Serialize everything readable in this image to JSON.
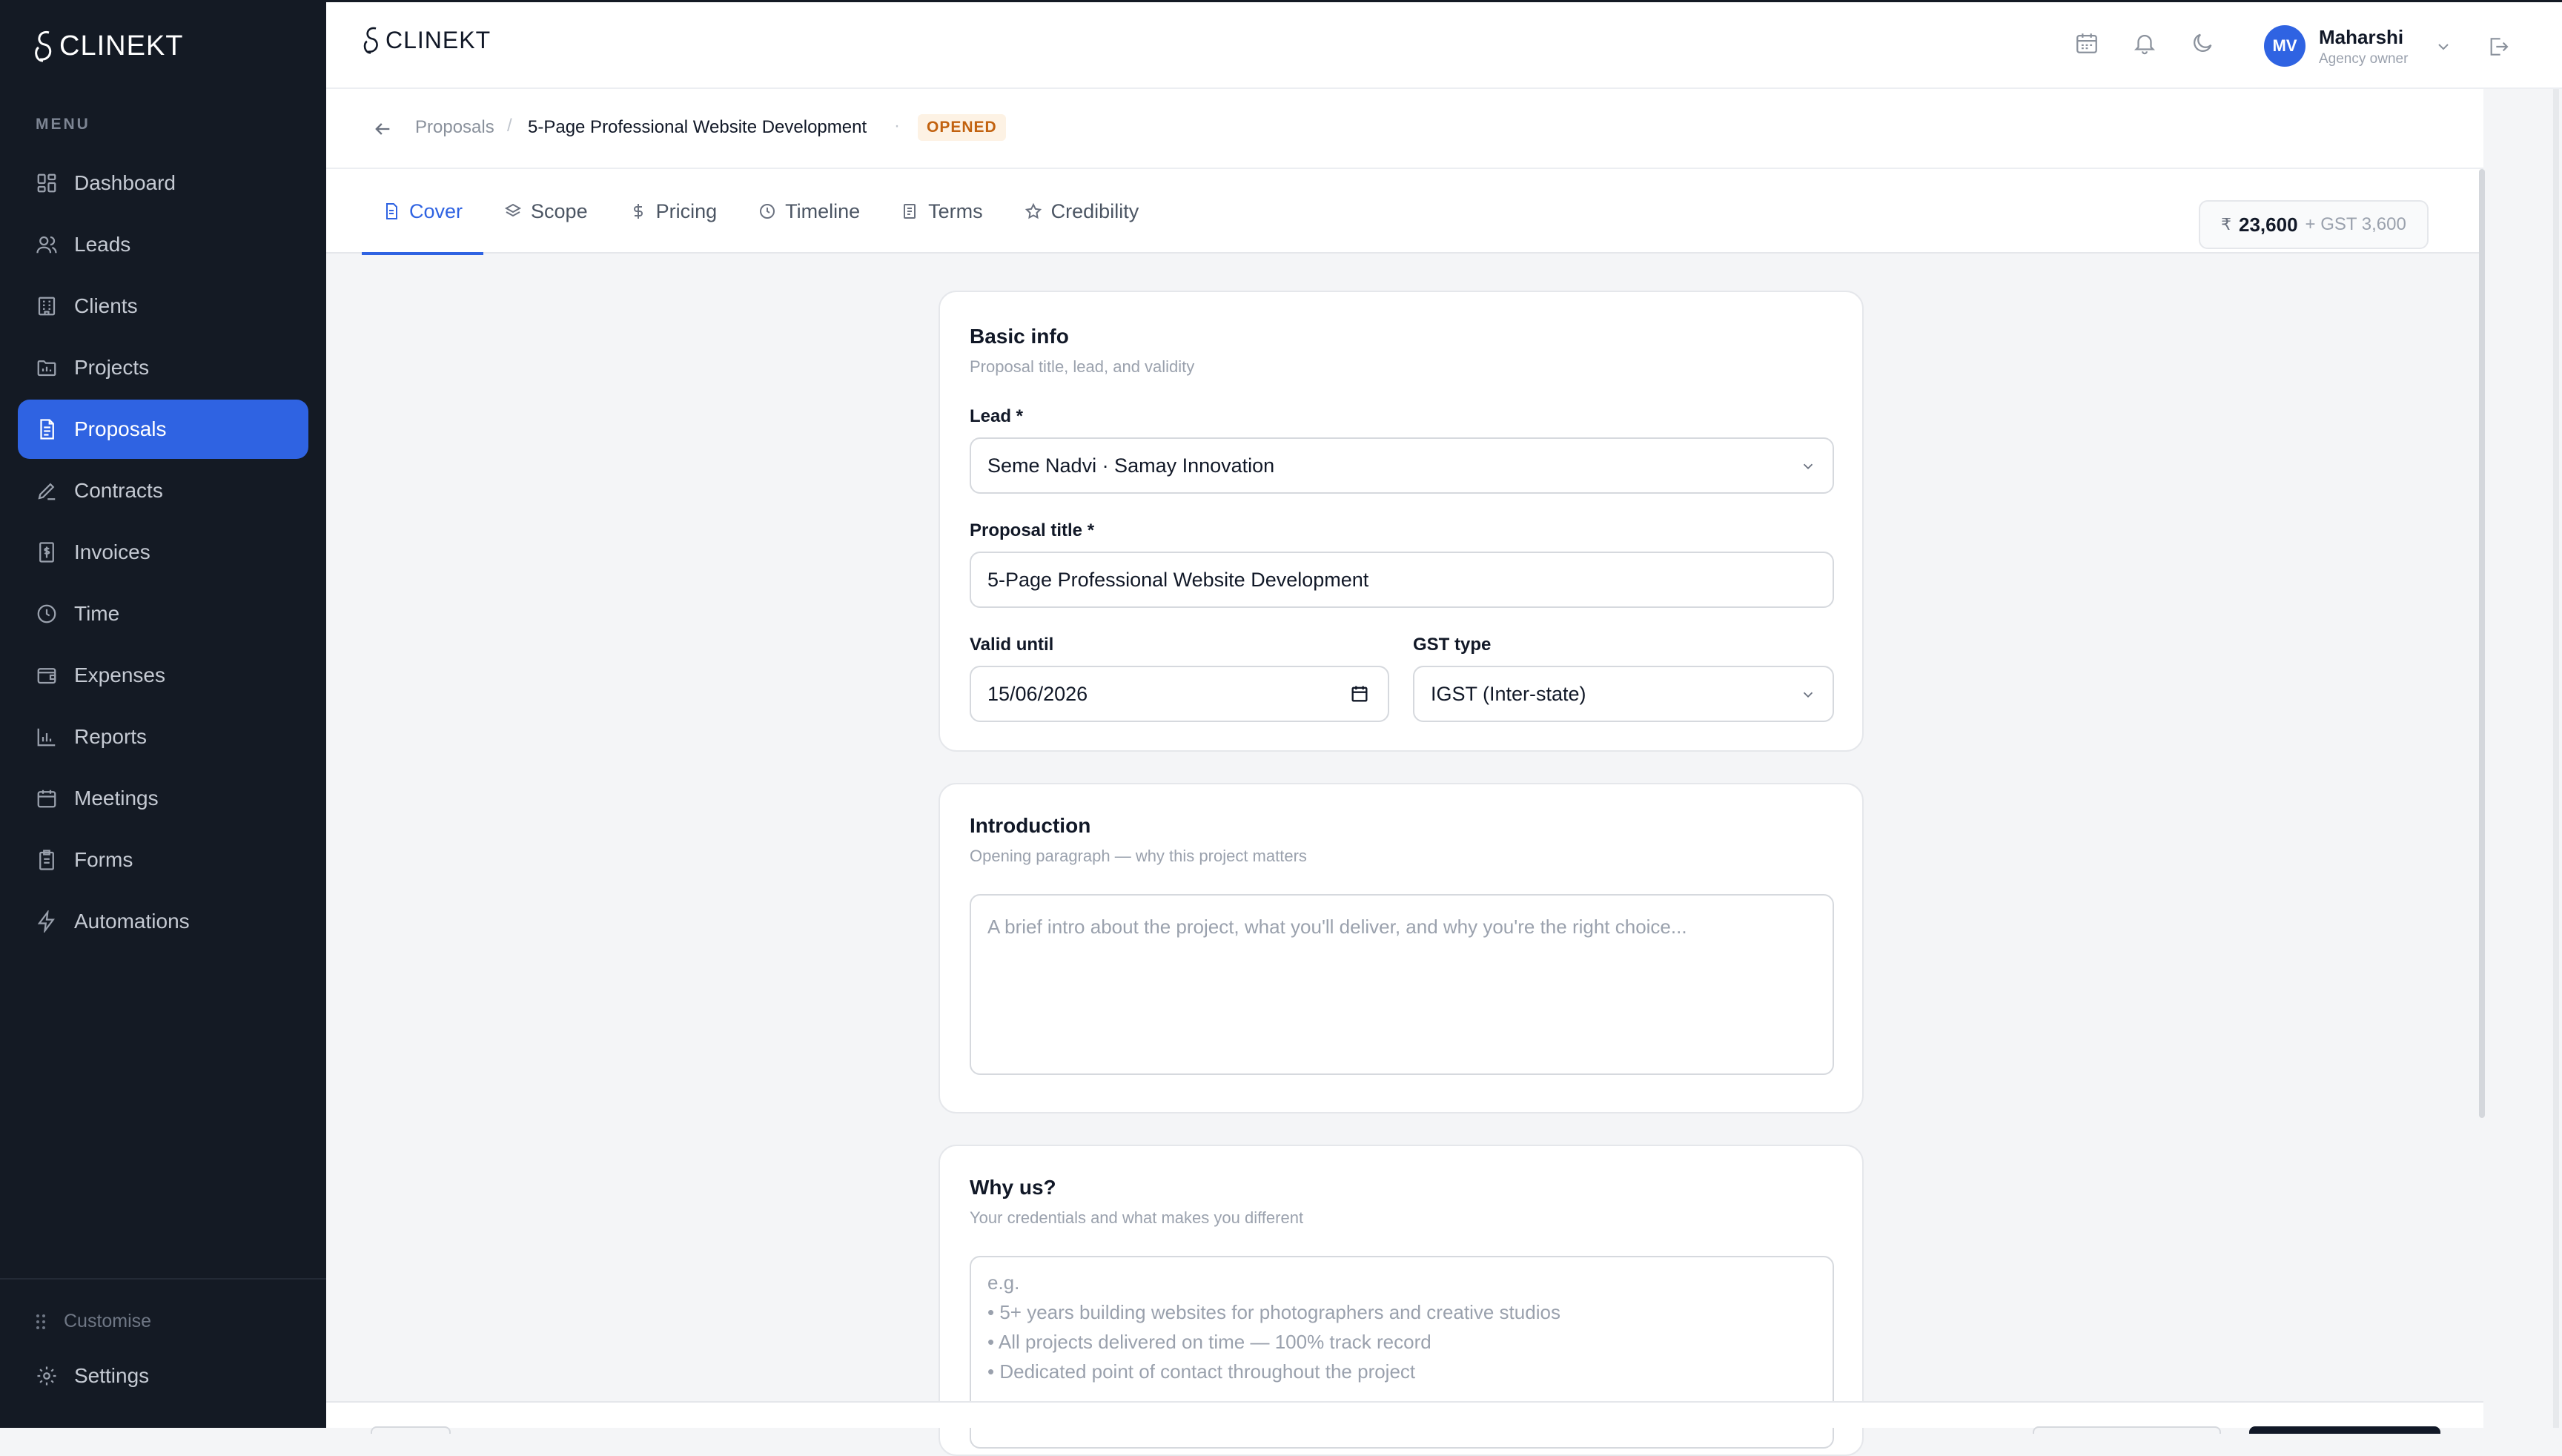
{
  "app": {
    "logo_text": "CLINEKT"
  },
  "sidebar": {
    "menu_label": "MENU",
    "items": [
      {
        "label": "Dashboard",
        "icon": "grid-icon"
      },
      {
        "label": "Leads",
        "icon": "users-icon"
      },
      {
        "label": "Clients",
        "icon": "building-icon"
      },
      {
        "label": "Projects",
        "icon": "folder-chart-icon"
      },
      {
        "label": "Proposals",
        "icon": "file-text-icon",
        "active": true
      },
      {
        "label": "Contracts",
        "icon": "pen-icon"
      },
      {
        "label": "Invoices",
        "icon": "receipt-icon"
      },
      {
        "label": "Time",
        "icon": "clock-icon"
      },
      {
        "label": "Expenses",
        "icon": "wallet-icon"
      },
      {
        "label": "Reports",
        "icon": "bar-chart-icon"
      },
      {
        "label": "Meetings",
        "icon": "calendar-icon"
      },
      {
        "label": "Forms",
        "icon": "clipboard-icon"
      },
      {
        "label": "Automations",
        "icon": "lightning-icon"
      }
    ],
    "customise_label": "Customise",
    "settings_label": "Settings"
  },
  "topbar": {
    "user": {
      "initials": "MV",
      "name": "Maharshi",
      "role": "Agency owner"
    }
  },
  "breadcrumb": {
    "parent": "Proposals",
    "separator": "/",
    "current": "5-Page Professional Website Development",
    "dot": "·",
    "status": "OPENED"
  },
  "tabs": [
    {
      "label": "Cover",
      "icon": "file-icon",
      "active": true
    },
    {
      "label": "Scope",
      "icon": "layers-icon"
    },
    {
      "label": "Pricing",
      "icon": "dollar-icon"
    },
    {
      "label": "Timeline",
      "icon": "clock-icon"
    },
    {
      "label": "Terms",
      "icon": "document-icon"
    },
    {
      "label": "Credibility",
      "icon": "star-icon"
    }
  ],
  "total": {
    "currency": "₹",
    "amount": "23,600",
    "gst": "+ GST 3,600"
  },
  "basic_info": {
    "title": "Basic info",
    "subtitle": "Proposal title, lead, and validity",
    "lead_label": "Lead *",
    "lead_value": "Seme Nadvi · Samay Innovation",
    "title_label": "Proposal title *",
    "title_value": "5-Page Professional Website Development",
    "valid_label": "Valid until",
    "valid_value": "15/06/2026",
    "gst_label": "GST type",
    "gst_value": "IGST (Inter-state)"
  },
  "introduction": {
    "title": "Introduction",
    "subtitle": "Opening paragraph — why this project matters",
    "placeholder": "A brief intro about the project, what you'll deliver, and why you're the right choice..."
  },
  "why_us": {
    "title": "Why us?",
    "subtitle": "Your credentials and what makes you different",
    "placeholder": "e.g.\n• 5+ years building websites for photographers and creative studios\n• All projects delivered on time — 100% track record\n• Dedicated point of contact throughout the project"
  },
  "colors": {
    "accent": "#2f63e2",
    "sidebar_bg": "#141a24",
    "status": "#c2620f"
  }
}
